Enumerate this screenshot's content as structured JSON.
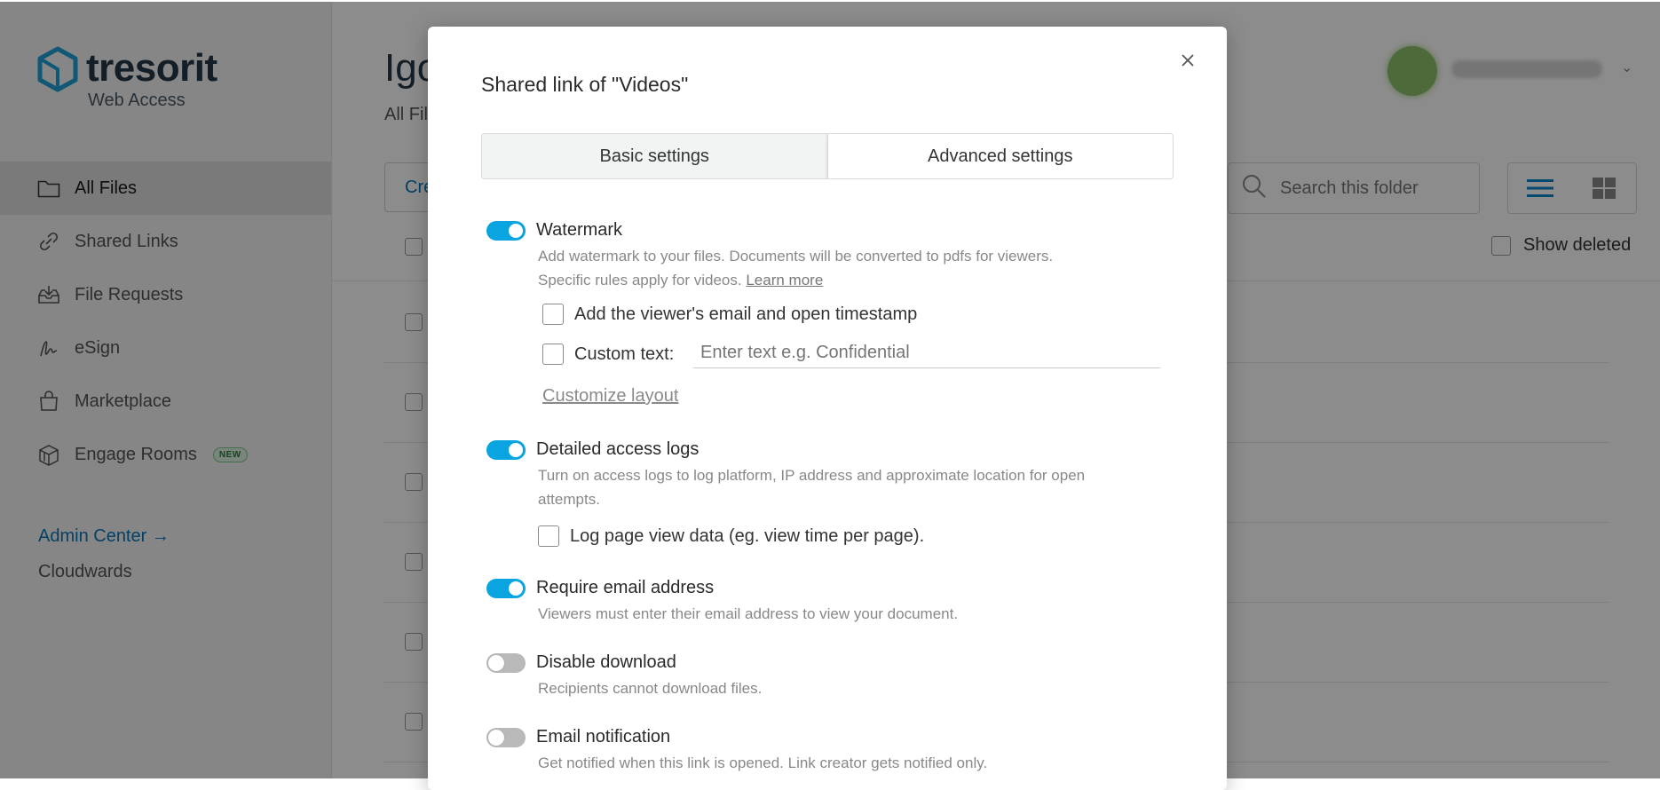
{
  "sidebar": {
    "logo_word": "tresorit",
    "logo_sub": "Web Access",
    "items": [
      {
        "label": "All Files",
        "icon": "folder-icon",
        "active": true
      },
      {
        "label": "Shared Links",
        "icon": "link-icon"
      },
      {
        "label": "File Requests",
        "icon": "inbox-download-icon"
      },
      {
        "label": "eSign",
        "icon": "signature-icon"
      },
      {
        "label": "Marketplace",
        "icon": "shopping-bag-icon"
      },
      {
        "label": "Engage Rooms",
        "icon": "rooms-icon",
        "badge": "NEW"
      }
    ],
    "admin_center": "Admin Center →",
    "org_name": "Cloudwards"
  },
  "main": {
    "title_partial": "Igo",
    "breadcrumb_partial": "All Fil",
    "create_partial": "Cre",
    "search_placeholder": "Search this folder",
    "show_deleted": "Show deleted"
  },
  "modal": {
    "title": "Shared link of \"Videos\"",
    "tabs": [
      {
        "label": "Basic settings",
        "active": false
      },
      {
        "label": "Advanced settings",
        "active": true
      }
    ],
    "watermark": {
      "title": "Watermark",
      "enabled": true,
      "desc_1": "Add watermark to your files. Documents will be converted to pdfs for viewers.",
      "desc_2": "Specific rules apply for videos.",
      "learn_more": "Learn more",
      "opt_email": "Add the viewer's email and open timestamp",
      "opt_custom": "Custom text:",
      "custom_placeholder": "Enter text e.g. Confidential",
      "customize_layout": "Customize layout"
    },
    "access_logs": {
      "title": "Detailed access logs",
      "enabled": true,
      "desc_1": "Turn on access logs to log platform, IP address and approximate location for open",
      "desc_2": "attempts.",
      "opt_page_view": "Log page view data (eg. view time per page)."
    },
    "require_email": {
      "title": "Require email address",
      "enabled": true,
      "desc": "Viewers must enter their email address to view your document."
    },
    "disable_download": {
      "title": "Disable download",
      "enabled": false,
      "desc": "Recipients cannot download files."
    },
    "email_notification": {
      "title": "Email notification",
      "enabled": false,
      "desc": "Get notified when this link is opened. Link creator gets notified only."
    }
  },
  "colors": {
    "accent": "#0aa5e0",
    "link": "#0a76b8",
    "brand_dark": "#253746"
  }
}
